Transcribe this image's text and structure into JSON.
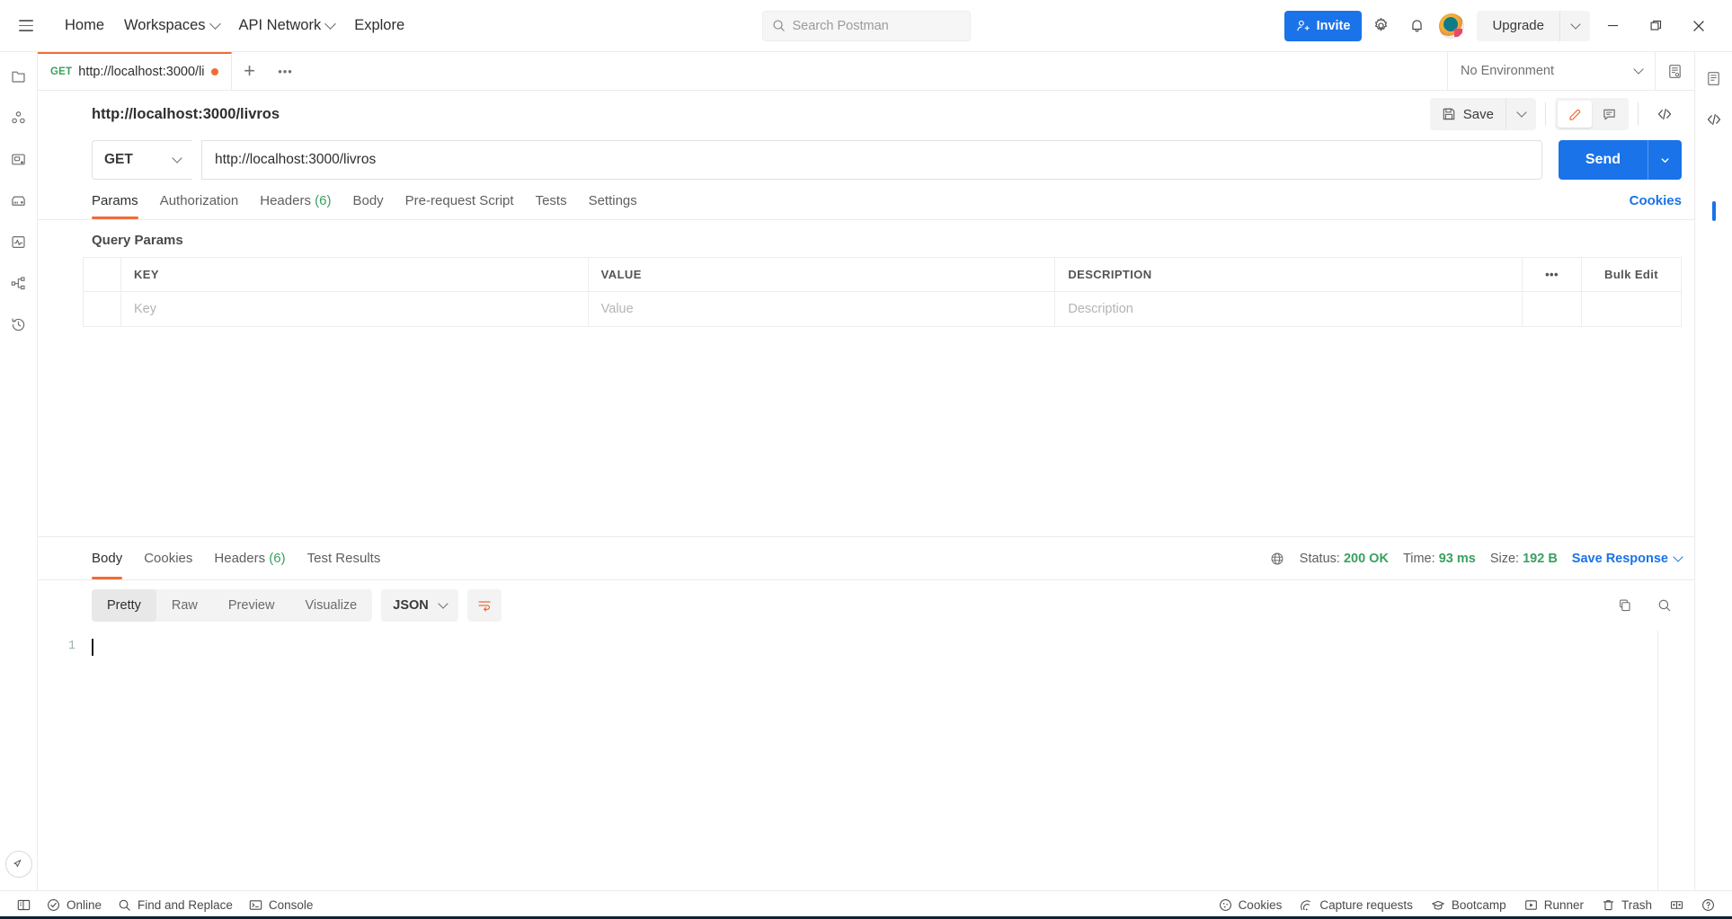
{
  "header": {
    "menu_icon": "hamburger-icon",
    "nav": [
      {
        "label": "Home",
        "caret": false
      },
      {
        "label": "Workspaces",
        "caret": true
      },
      {
        "label": "API Network",
        "caret": true
      },
      {
        "label": "Explore",
        "caret": false
      }
    ],
    "search": {
      "placeholder": "Search Postman",
      "icon": "search-icon"
    },
    "invite_label": "Invite",
    "settings_icon": "gear-icon",
    "notifications_icon": "bell-icon",
    "avatar": "user-avatar",
    "upgrade_label": "Upgrade",
    "window_controls": {
      "minimize": "minimize-icon",
      "maximize": "maximize-icon",
      "close": "close-icon"
    }
  },
  "sidebar": {
    "items": [
      {
        "name": "collections",
        "icon": "folder-icon"
      },
      {
        "name": "apis",
        "icon": "circles-icon"
      },
      {
        "name": "environments",
        "icon": "monitor-icon"
      },
      {
        "name": "mock-servers",
        "icon": "server-icon"
      },
      {
        "name": "monitors",
        "icon": "pulse-icon"
      },
      {
        "name": "flows",
        "icon": "nodes-icon"
      },
      {
        "name": "history",
        "icon": "clock-icon"
      }
    ],
    "bottom": {
      "name": "new-tour",
      "icon": "satellite-icon"
    }
  },
  "tabstrip": {
    "tab": {
      "method": "GET",
      "name": "http://localhost:3000/li",
      "unsaved": true
    },
    "new_tab_icon": "plus-icon",
    "more_icon": "ellipsis-icon",
    "environment": {
      "selected": "No Environment",
      "eye_icon": "environment-quicklook-icon"
    }
  },
  "request": {
    "title": "http://localhost:3000/livros",
    "save_label": "Save",
    "save_icon": "floppy-icon",
    "edit_icon": "pencil-icon",
    "comment_icon": "comment-icon",
    "code_icon": "code-icon",
    "method": "GET",
    "url": "http://localhost:3000/livros",
    "send_label": "Send",
    "tabs": [
      {
        "label": "Params",
        "count": "",
        "active": true
      },
      {
        "label": "Authorization",
        "count": "",
        "active": false
      },
      {
        "label": "Headers",
        "count": "(6)",
        "active": false
      },
      {
        "label": "Body",
        "count": "",
        "active": false
      },
      {
        "label": "Pre-request Script",
        "count": "",
        "active": false
      },
      {
        "label": "Tests",
        "count": "",
        "active": false
      },
      {
        "label": "Settings",
        "count": "",
        "active": false
      }
    ],
    "cookies_link": "Cookies",
    "query_params_label": "Query Params",
    "table": {
      "headers": [
        "KEY",
        "VALUE",
        "DESCRIPTION"
      ],
      "more_icon": "ellipsis-icon",
      "bulk_edit_label": "Bulk Edit",
      "placeholder_row": [
        "Key",
        "Value",
        "Description"
      ]
    }
  },
  "response": {
    "tabs": [
      {
        "label": "Body",
        "count": "",
        "active": true
      },
      {
        "label": "Cookies",
        "count": "",
        "active": false
      },
      {
        "label": "Headers",
        "count": "(6)",
        "active": false
      },
      {
        "label": "Test Results",
        "count": "",
        "active": false
      }
    ],
    "globe_icon": "globe-icon",
    "status_label": "Status:",
    "status_value": "200 OK",
    "time_label": "Time:",
    "time_value": "93 ms",
    "size_label": "Size:",
    "size_value": "192 B",
    "save_response_label": "Save Response",
    "view_modes": [
      {
        "label": "Pretty",
        "active": true
      },
      {
        "label": "Raw",
        "active": false
      },
      {
        "label": "Preview",
        "active": false
      },
      {
        "label": "Visualize",
        "active": false
      }
    ],
    "format": "JSON",
    "wrap_icon": "wrap-lines-icon",
    "copy_icon": "copy-icon",
    "search_icon": "search-icon",
    "body_lines": [
      "1"
    ],
    "body_text": ""
  },
  "footer": {
    "left": [
      {
        "label": "",
        "icon": "sidebar-toggle-icon"
      },
      {
        "label": "Online",
        "icon": "check-circle-icon"
      },
      {
        "label": "Find and Replace",
        "icon": "search-icon"
      },
      {
        "label": "Console",
        "icon": "terminal-icon"
      }
    ],
    "right": [
      {
        "label": "Cookies",
        "icon": "cookie-icon"
      },
      {
        "label": "Capture requests",
        "icon": "satellite-dish-icon"
      },
      {
        "label": "Bootcamp",
        "icon": "graduation-cap-icon"
      },
      {
        "label": "Runner",
        "icon": "play-box-icon"
      },
      {
        "label": "Trash",
        "icon": "trash-icon"
      },
      {
        "label": "",
        "icon": "layout-icon"
      },
      {
        "label": "",
        "icon": "help-circle-icon"
      }
    ]
  },
  "colors": {
    "accent": "#f06c37",
    "primary": "#1a73e8",
    "success": "#3aa05f",
    "border": "#ebebeb"
  }
}
